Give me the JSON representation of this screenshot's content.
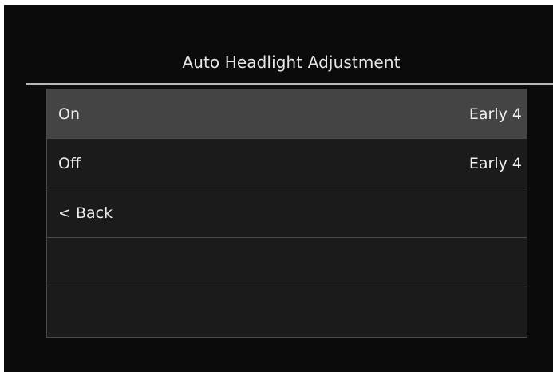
{
  "header": {
    "title": "Auto Headlight Adjustment"
  },
  "menu": {
    "items": [
      {
        "label": "On",
        "value": "Early 4",
        "selected": true
      },
      {
        "label": "Off",
        "value": "Early 4",
        "selected": false
      },
      {
        "label": "< Back",
        "value": "",
        "selected": false
      }
    ]
  },
  "colors": {
    "screen_background": "#0b0b0b",
    "row_background": "#1b1b1b",
    "selected_row_background": "#444444",
    "divider": "#4a4a4a",
    "title_rule": "#b8b8b8",
    "text": "#ececec"
  }
}
